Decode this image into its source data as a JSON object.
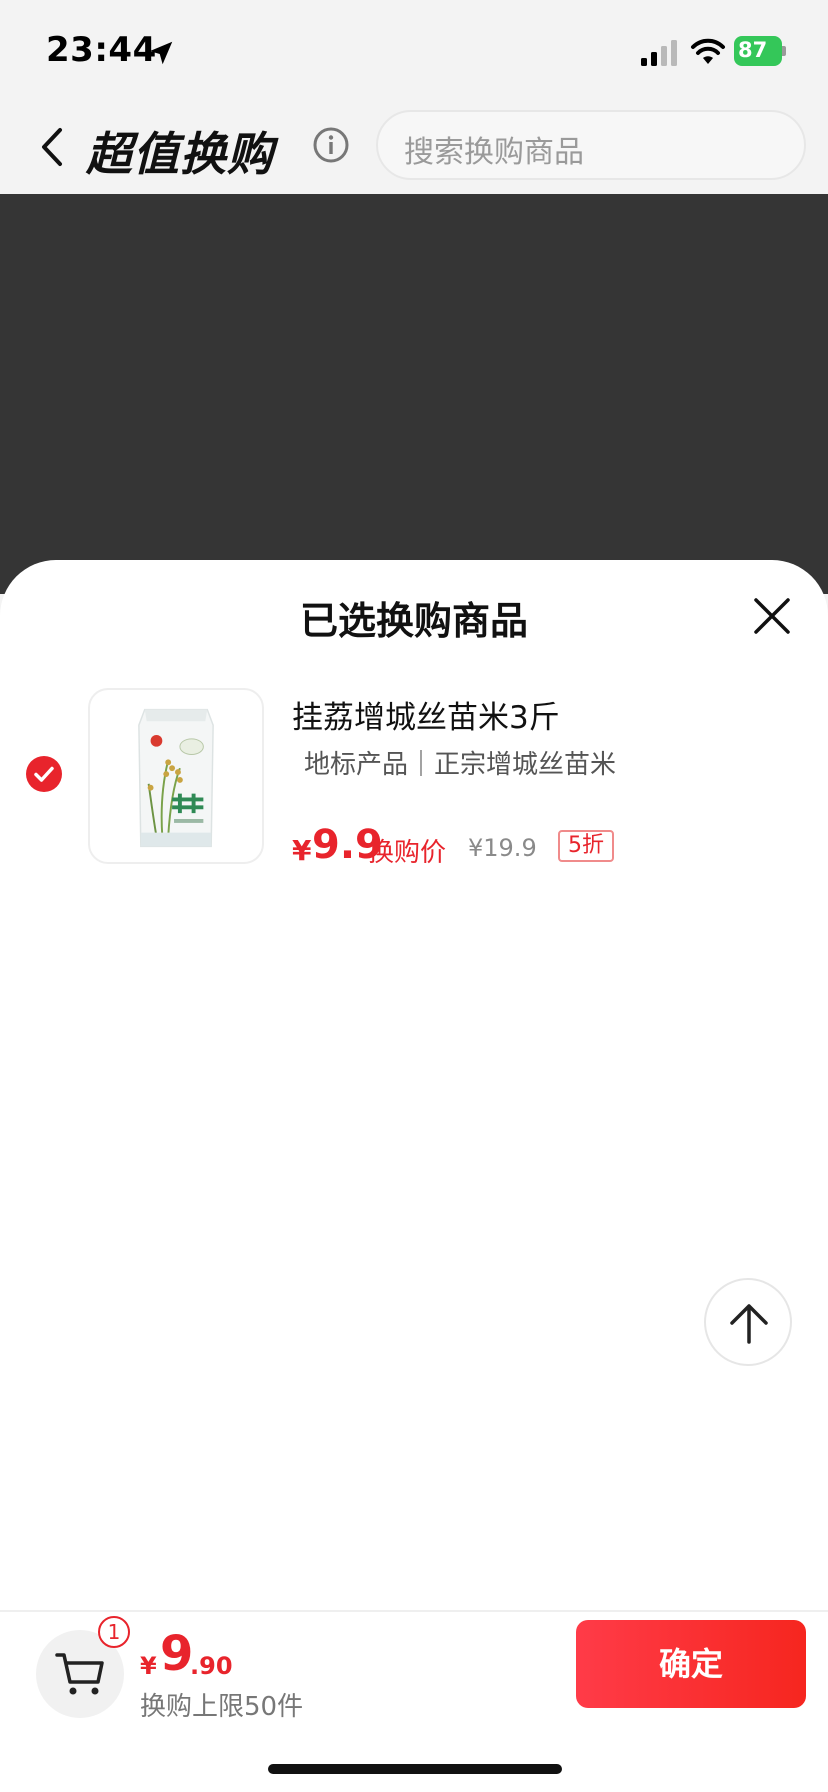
{
  "status_bar": {
    "time": "23:44",
    "battery": "87",
    "icons": [
      "location-arrow-icon",
      "cellular-signal-icon",
      "wifi-icon",
      "battery-charging-icon"
    ]
  },
  "header": {
    "title": "超值换购",
    "search_placeholder": "搜索换购商品",
    "icons": [
      "chevron-left-icon",
      "info-icon"
    ]
  },
  "sheet": {
    "title": "已选换购商品",
    "items": [
      {
        "name": "挂荔增城丝苗米3斤",
        "desc": "地标产品｜正宗增城丝苗米",
        "price_symbol": "¥",
        "price": "9.9",
        "price_label": "换购价",
        "original_price": "¥19.9",
        "discount": "5折",
        "selected": true
      }
    ],
    "icons": [
      "close-icon",
      "checkmark-circle-icon",
      "arrow-up-icon"
    ]
  },
  "bottom_bar": {
    "cart_count": "1",
    "total_symbol": "¥",
    "total_int": "9",
    "total_dec": ".90",
    "limit_text": "换购上限50件",
    "confirm_label": "确定"
  },
  "colors": {
    "accent": "#e8242c",
    "overlay": "#353535",
    "battery": "#34c759"
  }
}
